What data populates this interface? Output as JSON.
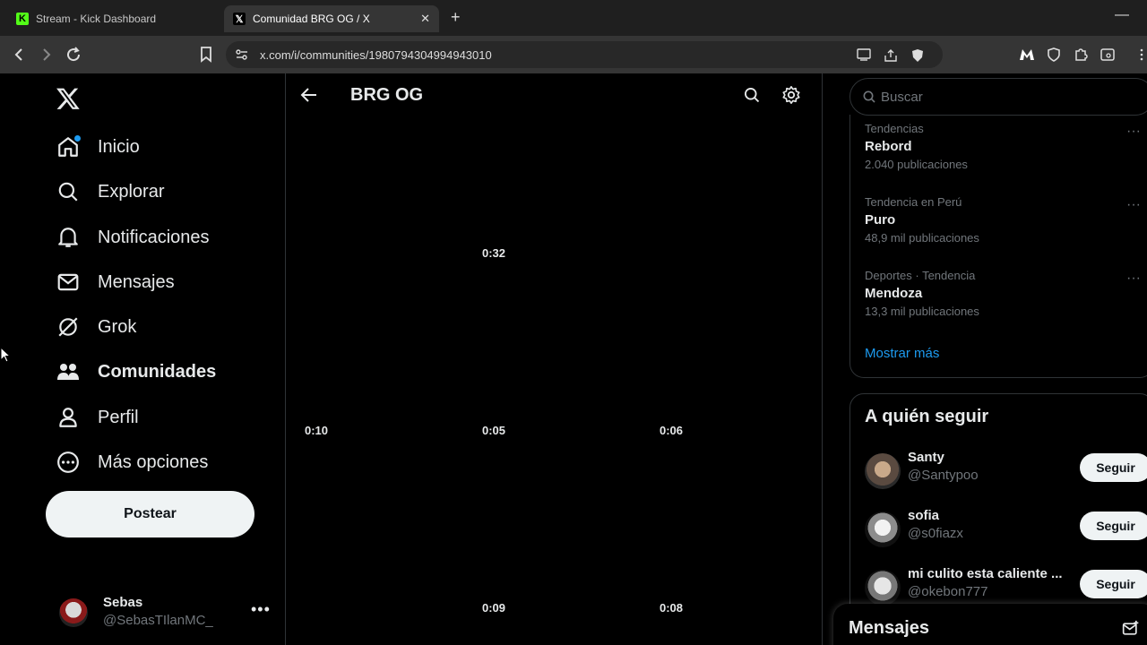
{
  "browser": {
    "tabs": [
      {
        "title": "Stream - Kick Dashboard",
        "favicon": "kick-icon",
        "active": false
      },
      {
        "title": "Comunidad BRG OG / X",
        "favicon": "x-icon",
        "active": true
      }
    ],
    "url": "x.com/i/communities/1980794304994943010"
  },
  "nav": {
    "items": [
      {
        "label": "Inicio",
        "icon": "home-icon"
      },
      {
        "label": "Explorar",
        "icon": "search-icon"
      },
      {
        "label": "Notificaciones",
        "icon": "bell-icon"
      },
      {
        "label": "Mensajes",
        "icon": "mail-icon"
      },
      {
        "label": "Grok",
        "icon": "grok-icon"
      },
      {
        "label": "Comunidades",
        "icon": "communities-icon"
      },
      {
        "label": "Perfil",
        "icon": "profile-icon"
      },
      {
        "label": "Más opciones",
        "icon": "more-options-icon"
      }
    ],
    "post_label": "Postear",
    "account": {
      "name": "Sebas",
      "handle": "@SebasTIlanMC_"
    }
  },
  "community": {
    "title": "BRG OG",
    "video_durations": [
      "0:32",
      "0:10",
      "0:05",
      "0:06",
      "0:09",
      "0:08"
    ]
  },
  "right": {
    "search_placeholder": "Buscar",
    "trends": [
      {
        "context": "Tendencias",
        "name": "Rebord",
        "count": "2.040 publicaciones"
      },
      {
        "context": "Tendencia en Perú",
        "name": "Puro",
        "count": "48,9 mil publicaciones"
      },
      {
        "context": "Deportes · Tendencia",
        "name": "Mendoza",
        "count": "13,3 mil publicaciones"
      }
    ],
    "show_more": "Mostrar más",
    "who_to_follow": {
      "title": "A quién seguir",
      "follow_label": "Seguir",
      "users": [
        {
          "name": "Santy",
          "handle": "@Santypoo"
        },
        {
          "name": "sofia",
          "handle": "@s0fiazx"
        },
        {
          "name": "mi culito esta caliente ...",
          "handle": "@okebon777"
        }
      ]
    },
    "messages_title": "Mensajes"
  },
  "colors": {
    "accent": "#1d9bf0",
    "background": "#000000",
    "secondary_text": "#71767b",
    "border": "#2f3336"
  }
}
